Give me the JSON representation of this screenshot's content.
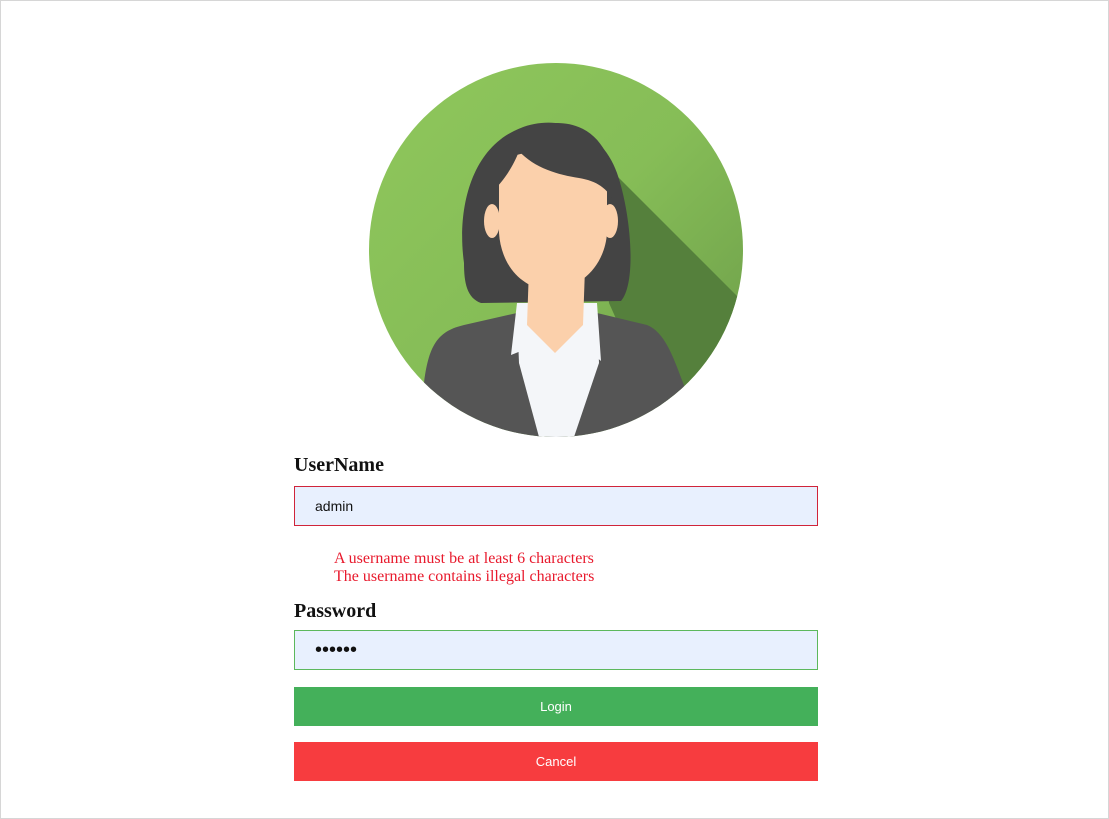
{
  "avatar": {
    "icon": "businesswoman-avatar-icon",
    "background_color": "#8bc25a",
    "shadow_color": "#55803c"
  },
  "form": {
    "username": {
      "label": "UserName",
      "value": "admin",
      "state": "invalid",
      "errors": [
        "A username must be at least 6 characters",
        "The username contains illegal characters"
      ]
    },
    "password": {
      "label": "Password",
      "value": "••••••",
      "state": "valid"
    },
    "login_label": "Login",
    "cancel_label": "Cancel"
  },
  "colors": {
    "login_button": "#44b05a",
    "cancel_button": "#f73c3f",
    "error_text": "#e8192c",
    "input_background": "#e8f0fe"
  }
}
